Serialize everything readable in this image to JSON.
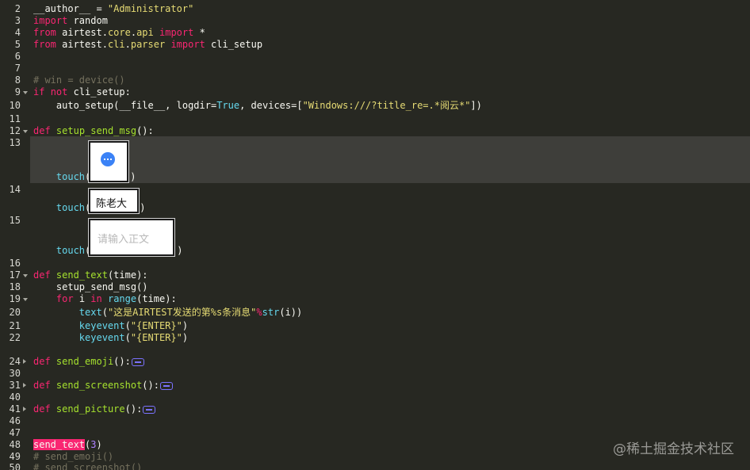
{
  "line_numbers": [
    {
      "num": "2",
      "fold": ""
    },
    {
      "num": "3",
      "fold": ""
    },
    {
      "num": "4",
      "fold": ""
    },
    {
      "num": "5",
      "fold": ""
    },
    {
      "num": "6",
      "fold": ""
    },
    {
      "num": "7",
      "fold": ""
    },
    {
      "num": "8",
      "fold": ""
    },
    {
      "num": "9",
      "fold": "open"
    },
    {
      "num": "10",
      "fold": ""
    },
    {
      "num": "11",
      "fold": ""
    },
    {
      "num": "12",
      "fold": "open"
    },
    {
      "num": "13",
      "fold": ""
    },
    {
      "num": "14",
      "fold": ""
    },
    {
      "num": "15",
      "fold": ""
    },
    {
      "num": "16",
      "fold": ""
    },
    {
      "num": "17",
      "fold": "open"
    },
    {
      "num": "18",
      "fold": ""
    },
    {
      "num": "19",
      "fold": "open"
    },
    {
      "num": "20",
      "fold": ""
    },
    {
      "num": "21",
      "fold": ""
    },
    {
      "num": "22",
      "fold": ""
    },
    {
      "num": "24",
      "fold": "closed"
    },
    {
      "num": "30",
      "fold": ""
    },
    {
      "num": "31",
      "fold": "closed"
    },
    {
      "num": "40",
      "fold": ""
    },
    {
      "num": "41",
      "fold": "closed"
    },
    {
      "num": "46",
      "fold": ""
    },
    {
      "num": "47",
      "fold": ""
    },
    {
      "num": "48",
      "fold": ""
    },
    {
      "num": "49",
      "fold": ""
    },
    {
      "num": "50",
      "fold": ""
    }
  ],
  "code": {
    "l2": {
      "a": "__author__ = ",
      "b": "\"Administrator\""
    },
    "l3": {
      "a": "import",
      "b": " random"
    },
    "l4": {
      "a": "from",
      "b": " airtest.",
      "c": "core",
      "d": ".",
      "e": "api",
      "f": " ",
      "g": "import",
      "h": " *"
    },
    "l5": {
      "a": "from",
      "b": " airtest.",
      "c": "cli",
      "d": ".",
      "e": "parser",
      "f": " ",
      "g": "import",
      "h": " cli_setup"
    },
    "l8": {
      "a": "# win = device()"
    },
    "l9": {
      "a": "if",
      "b": " ",
      "c": "not",
      "d": " cli_setup:"
    },
    "l10": {
      "a": "    auto_setup(__file__, logdir=",
      "b": "True",
      "c": ", devices=[",
      "d": "\"Windows:///?title_re=.*阅云*\"",
      "e": "])"
    },
    "l12": {
      "a": "def",
      "b": " ",
      "c": "setup_send_msg",
      "d": "():"
    },
    "l13": {
      "a": "    touch(",
      "b": ")"
    },
    "l14": {
      "a": "    touch(",
      "b": ")"
    },
    "l15": {
      "a": "    touch(",
      "b": ")"
    },
    "l17": {
      "a": "def",
      "b": " ",
      "c": "send_text",
      "d": "(time):"
    },
    "l18": {
      "a": "    setup_send_msg()"
    },
    "l19": {
      "a": "    ",
      "b": "for",
      "c": " i ",
      "d": "in",
      "e": " ",
      "f": "range",
      "g": "(time):"
    },
    "l20": {
      "a": "        ",
      "b": "text",
      "c": "(",
      "d": "\"这是AIRTEST发送的第%s条消息\"",
      "e": "%",
      "f": "str",
      "g": "(i))"
    },
    "l21": {
      "a": "        ",
      "b": "keyevent",
      "c": "(",
      "d": "\"{ENTER}\"",
      "e": ")"
    },
    "l22": {
      "a": "        ",
      "b": "keyevent",
      "c": "(",
      "d": "\"{ENTER}\"",
      "e": ")"
    },
    "l24": {
      "a": "def",
      "b": " ",
      "c": "send_emoji",
      "d": "():"
    },
    "l31": {
      "a": "def",
      "b": " ",
      "c": "send_screenshot",
      "d": "():"
    },
    "l41": {
      "a": "def",
      "b": " ",
      "c": "send_picture",
      "d": "():"
    },
    "l48": {
      "a": "send_text",
      "b": "(",
      "c": "3",
      "d": ")"
    },
    "l49": {
      "a": "# send_emoji()"
    },
    "l50": {
      "a": "# send_screenshot()"
    }
  },
  "image_templates": {
    "chat_icon": "chat-bubble-icon",
    "contact_name": "陈老大",
    "input_placeholder": "请输入正文"
  },
  "watermark": "@稀土掘金技术社区",
  "colors": {
    "background": "#272822",
    "keyword": "#f92672",
    "string": "#e6db74",
    "comment": "#75715e",
    "function": "#a6e22e",
    "builtin": "#66d9ef",
    "number": "#ae81ff"
  }
}
